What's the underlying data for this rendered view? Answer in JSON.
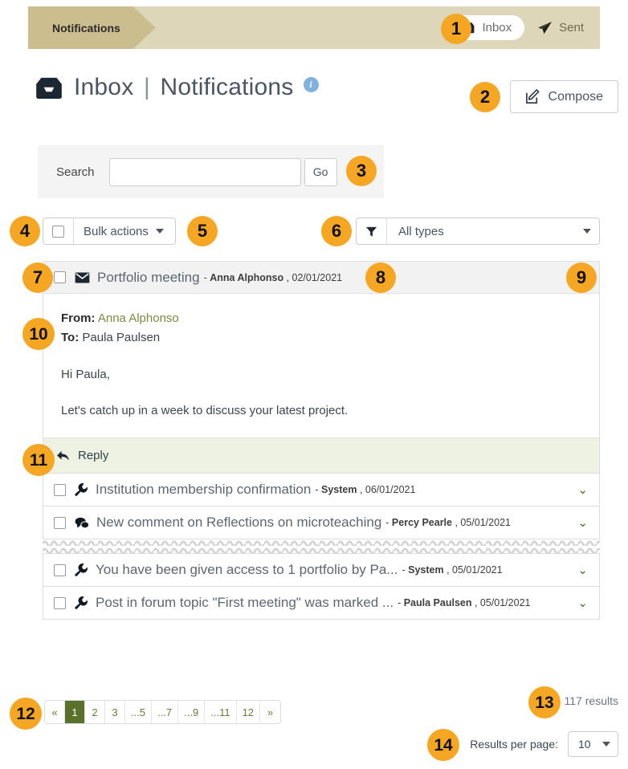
{
  "topbar": {
    "tab_label": "Notifications",
    "inbox_label": "Inbox",
    "sent_label": "Sent"
  },
  "page": {
    "title_main": "Inbox",
    "title_sep": "|",
    "title_sub": "Notifications",
    "info_glyph": "i",
    "compose_label": "Compose"
  },
  "search": {
    "label": "Search",
    "value": "",
    "placeholder": "",
    "go_label": "Go"
  },
  "toolbar": {
    "bulk_actions_label": "Bulk actions",
    "filter_value": "All types"
  },
  "messages": [
    {
      "subject": "Portfolio meeting",
      "sender": "Anna Alphonso",
      "date": "02/01/2021",
      "icon": "envelope-icon",
      "expanded": true,
      "from_label": "From:",
      "from_value": "Anna Alphonso",
      "to_label": "To:",
      "to_value": "Paula Paulsen",
      "greeting": "Hi Paula,",
      "body": "Let's catch up in a week to discuss your latest project.",
      "reply_label": "Reply",
      "chevron": "up"
    },
    {
      "subject": "Institution membership confirmation",
      "sender": "System",
      "date": "06/01/2021",
      "icon": "wrench-icon",
      "expanded": false,
      "chevron": "down"
    },
    {
      "subject": "New comment on Reflections on microteaching",
      "sender": "Percy Pearle",
      "date": "05/01/2021",
      "icon": "comments-icon",
      "expanded": false,
      "chevron": "down"
    },
    {
      "subject": "You have been given access to 1 portfolio by Pa...",
      "sender": "System",
      "date": "05/01/2021",
      "icon": "wrench-icon",
      "expanded": false,
      "chevron": "down"
    },
    {
      "subject": "Post in forum topic \"First meeting\" was marked ...",
      "sender": "Paula Paulsen",
      "date": "05/01/2021",
      "icon": "wrench-icon",
      "expanded": false,
      "chevron": "down"
    }
  ],
  "pagination": {
    "prev": "«",
    "next": "»",
    "pages": [
      "1",
      "2",
      "3",
      "...5",
      "...7",
      "...9",
      "...11",
      "12"
    ],
    "active": "1",
    "results_text": "117 results"
  },
  "results_per_page": {
    "label": "Results per page:",
    "value": "10"
  },
  "callouts": [
    "1",
    "2",
    "3",
    "4",
    "5",
    "6",
    "7",
    "8",
    "9",
    "10",
    "11",
    "12",
    "13",
    "14"
  ],
  "colors": {
    "accent_badge": "#f5a623",
    "topbar_bg": "#ded6b8",
    "topbar_tab": "#cbbd8d",
    "active_page": "#5b7029",
    "reply_bg": "#eef2e3",
    "link_green": "#7a8b3e"
  }
}
